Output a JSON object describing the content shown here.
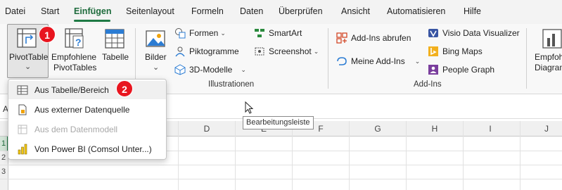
{
  "menu": {
    "tabs": [
      "Datei",
      "Start",
      "Einfügen",
      "Seitenlayout",
      "Formeln",
      "Daten",
      "Überprüfen",
      "Ansicht",
      "Automatisieren",
      "Hilfe"
    ],
    "active_tab": "Einfügen"
  },
  "ribbon": {
    "pivottable": {
      "label": "PivotTable",
      "caret": "⌄"
    },
    "recommended_pivot": {
      "line1": "Empfohlene",
      "line2": "PivotTables"
    },
    "table": {
      "label": "Tabelle"
    },
    "pictures": {
      "label": "Bilder",
      "caret": "⌄"
    },
    "illustrations": {
      "shapes": "Formen",
      "icons": "Piktogramme",
      "models3d": "3D-Modelle",
      "smartart": "SmartArt",
      "screenshot": "Screenshot",
      "group_label": "Illustrationen"
    },
    "addins": {
      "get_addins": "Add-Ins abrufen",
      "my_addins": "Meine Add-Ins",
      "visio": "Visio Data Visualizer",
      "bing_maps": "Bing Maps",
      "people_graph": "People Graph",
      "group_label": "Add-Ins"
    },
    "recommended_charts": {
      "line1": "Empfohle",
      "line2": "Diagram"
    }
  },
  "dropdown": {
    "items": [
      {
        "label": "Aus Tabelle/Bereich",
        "enabled": true
      },
      {
        "label": "Aus externer Datenquelle",
        "enabled": true
      },
      {
        "label": "Aus dem Datenmodell",
        "enabled": false
      },
      {
        "label": "Von Power BI (Comsol Unter...)",
        "enabled": true
      }
    ]
  },
  "badges": {
    "first": "1",
    "second": "2"
  },
  "tooltip": "Bearbeitungsleiste",
  "formula_bar": {
    "name_box_fragment": "A"
  },
  "grid": {
    "columns": [
      "D",
      "E",
      "F",
      "G",
      "H",
      "I",
      "J"
    ],
    "rows": [
      "1",
      "2",
      "3"
    ]
  },
  "colors": {
    "accent": "#1e7a44",
    "badge": "#e8151f"
  }
}
